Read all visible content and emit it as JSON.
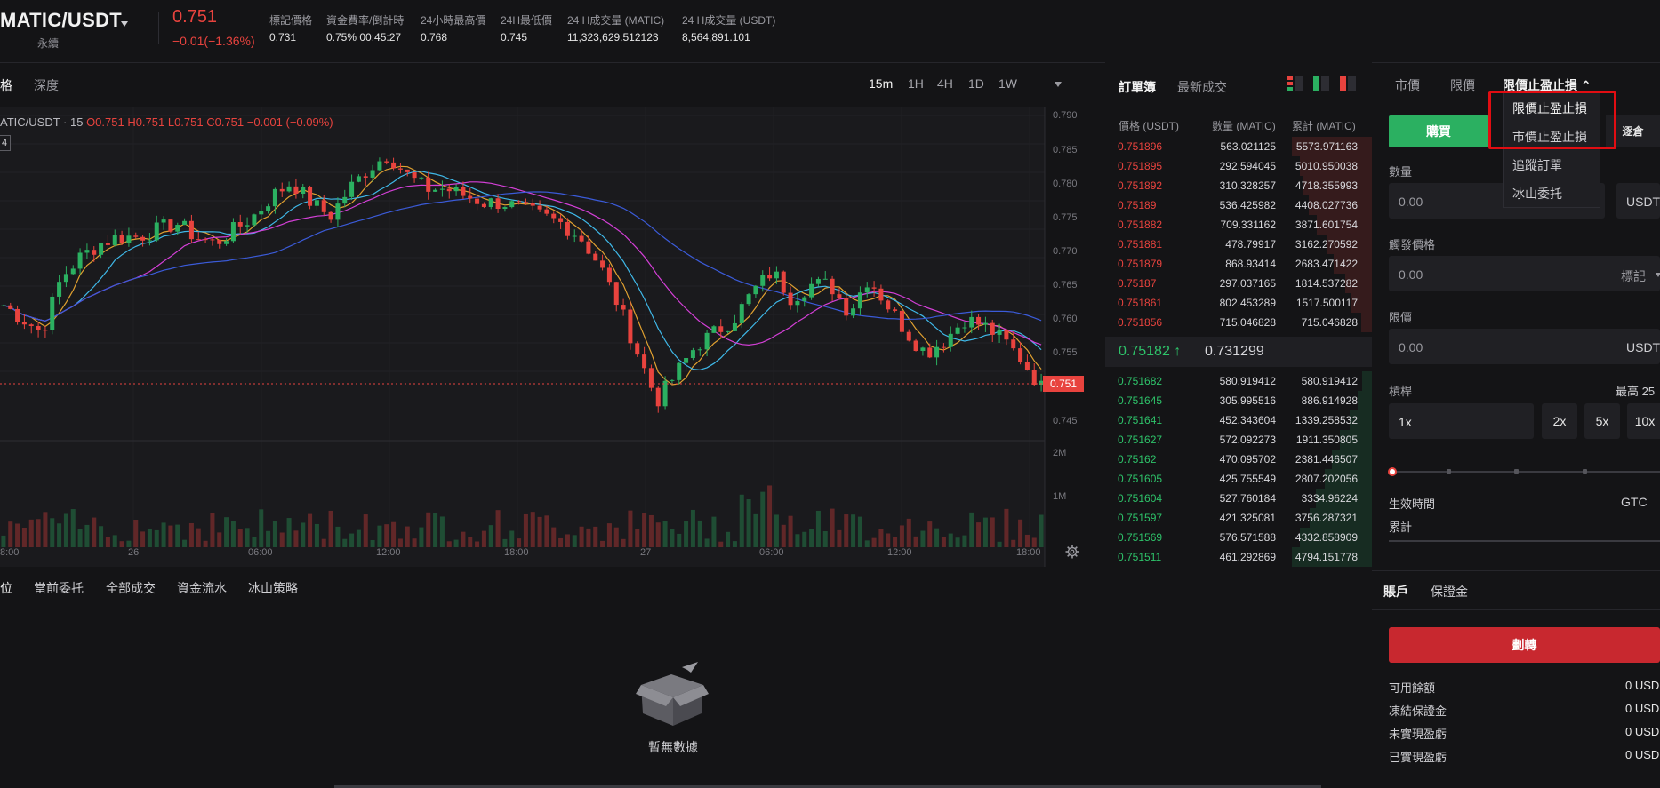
{
  "header": {
    "pair": "MATIC/USDT",
    "contract_type": "永續",
    "last_price": "0.751",
    "change": "−0.01(−1.36%)",
    "stats": [
      {
        "label": "標記價格",
        "value": "0.731"
      },
      {
        "label": "資金費率/倒計時",
        "value": "0.75% 00:45:27"
      },
      {
        "label": "24小時最高價",
        "value": "0.768"
      },
      {
        "label": "24H最低價",
        "value": "0.745"
      },
      {
        "label": "24 H成交量 (MATIC)",
        "value": "11,323,629.512123"
      },
      {
        "label": "24 H成交量 (USDT)",
        "value": "8,564,891.101"
      }
    ]
  },
  "chart_tabs": [
    "格",
    "深度"
  ],
  "timeframes": [
    "15m",
    "1H",
    "4H",
    "1D",
    "1W"
  ],
  "chart_legend": {
    "symbol": "ATIC/USDT · 15",
    "ohlc": "O0.751 H0.751 L0.751 C0.751 −0.001 (−0.09%)",
    "indicator_box": "4"
  },
  "chart_data": {
    "type": "candlestick",
    "y_ticks": [
      "0.790",
      "0.785",
      "0.780",
      "0.775",
      "0.770",
      "0.765",
      "0.760",
      "0.755",
      "0.750",
      "0.745"
    ],
    "ylim": [
      0.743,
      0.791
    ],
    "x_ticks": [
      "8:00",
      "26",
      "06:00",
      "12:00",
      "18:00",
      "27",
      "06:00",
      "12:00",
      "18:00"
    ],
    "volume_ticks": [
      "2M",
      "1M"
    ],
    "current_price": "0.751",
    "ohlc_path": [
      0.762,
      0.76,
      0.758,
      0.766,
      0.769,
      0.771,
      0.772,
      0.772,
      0.773,
      0.774,
      0.772,
      0.771,
      0.773,
      0.775,
      0.778,
      0.78,
      0.777,
      0.775,
      0.779,
      0.782,
      0.784,
      0.781,
      0.779,
      0.779,
      0.778,
      0.777,
      0.777,
      0.776,
      0.775,
      0.774,
      0.772,
      0.768,
      0.762,
      0.755,
      0.748,
      0.752,
      0.756,
      0.758,
      0.76,
      0.764,
      0.767,
      0.763,
      0.765,
      0.765,
      0.761,
      0.766,
      0.762,
      0.758,
      0.755,
      0.757,
      0.76,
      0.759,
      0.757,
      0.754,
      0.75
    ]
  },
  "orderbook": {
    "tabs": [
      "訂單簿",
      "最新成交"
    ],
    "headers": [
      "價格 (USDT)",
      "數量 (MATIC)",
      "累計 (MATIC)"
    ],
    "asks": [
      {
        "p": "0.751896",
        "q": "563.021125",
        "c": "5573.971163",
        "d": 1.0
      },
      {
        "p": "0.751895",
        "q": "292.594045",
        "c": "5010.950038",
        "d": 0.9
      },
      {
        "p": "0.751892",
        "q": "310.328257",
        "c": "4718.355993",
        "d": 0.85
      },
      {
        "p": "0.75189",
        "q": "536.425982",
        "c": "4408.027736",
        "d": 0.79
      },
      {
        "p": "0.751882",
        "q": "709.331162",
        "c": "3871.601754",
        "d": 0.69
      },
      {
        "p": "0.751881",
        "q": "478.79917",
        "c": "3162.270592",
        "d": 0.57
      },
      {
        "p": "0.751879",
        "q": "868.93414",
        "c": "2683.471422",
        "d": 0.48
      },
      {
        "p": "0.75187",
        "q": "297.037165",
        "c": "1814.537282",
        "d": 0.33
      },
      {
        "p": "0.751861",
        "q": "802.453289",
        "c": "1517.500117",
        "d": 0.27
      },
      {
        "p": "0.751856",
        "q": "715.046828",
        "c": "715.046828",
        "d": 0.13
      }
    ],
    "mid_price": "0.75182 ↑",
    "mark_price": "0.731299",
    "bids": [
      {
        "p": "0.751682",
        "q": "580.919412",
        "c": "580.919412",
        "d": 0.12
      },
      {
        "p": "0.751645",
        "q": "305.995516",
        "c": "886.914928",
        "d": 0.18
      },
      {
        "p": "0.751641",
        "q": "452.343604",
        "c": "1339.258532",
        "d": 0.28
      },
      {
        "p": "0.751627",
        "q": "572.092273",
        "c": "1911.350805",
        "d": 0.4
      },
      {
        "p": "0.75162",
        "q": "470.095702",
        "c": "2381.446507",
        "d": 0.5
      },
      {
        "p": "0.751605",
        "q": "425.755549",
        "c": "2807.202056",
        "d": 0.59
      },
      {
        "p": "0.751604",
        "q": "527.760184",
        "c": "3334.96224",
        "d": 0.7
      },
      {
        "p": "0.751597",
        "q": "421.325081",
        "c": "3756.287321",
        "d": 0.78
      },
      {
        "p": "0.751569",
        "q": "576.571588",
        "c": "4332.858909",
        "d": 0.9
      },
      {
        "p": "0.751511",
        "q": "461.292869",
        "c": "4794.151778",
        "d": 1.0
      }
    ]
  },
  "order_panel": {
    "types": [
      "市價",
      "限價",
      "限價止盈止損 ⌃"
    ],
    "buy": "購買",
    "margin_mode": "逐倉",
    "qty_label": "數量",
    "qty_value": "0.00",
    "qty_unit": "USDT",
    "trigger_label": "觸發價格",
    "trigger_value": "0.00",
    "trigger_unit": "標記",
    "limit_label": "限價",
    "limit_value": "0.00",
    "limit_unit": "USDT",
    "leverage_label": "槓桿",
    "leverage_max": "最高 25",
    "leverage_value": "1x",
    "leverage_options": [
      "2x",
      "5x",
      "10x"
    ],
    "tif_label": "生效時間",
    "tif_value": "GTC",
    "cumulative_label": "累計",
    "dropdown": [
      "限價止盈止損",
      "市價止盈止損",
      "追蹤訂單",
      "冰山委托"
    ]
  },
  "bottom_tabs": [
    "位",
    "當前委托",
    "全部成交",
    "資金流水",
    "冰山策略"
  ],
  "empty_text": "暫無數據",
  "account": {
    "tabs": [
      "賬戶",
      "保證金"
    ],
    "transfer": "劃轉",
    "rows": [
      {
        "label": "可用餘額",
        "value": "0 USD"
      },
      {
        "label": "凍結保證金",
        "value": "0 USD"
      },
      {
        "label": "未實現盈虧",
        "value": "0 USD"
      },
      {
        "label": "已實現盈虧",
        "value": "0 USD"
      }
    ]
  },
  "colors": {
    "up": "#2bb061",
    "down": "#e8433e",
    "accent_red": "#c8282f",
    "bg": "#141416"
  }
}
